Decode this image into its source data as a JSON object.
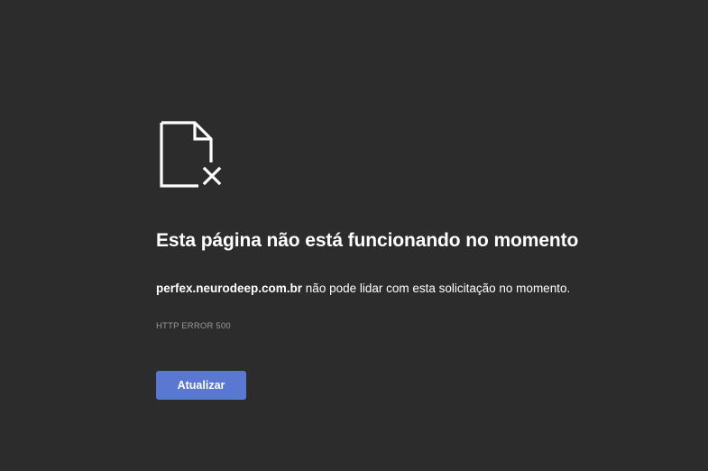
{
  "error_page": {
    "icon": "broken-document-icon",
    "title": "Esta página não está funcionando no momento",
    "host": "perfex.neurodeep.com.br",
    "message_suffix": " não pode lidar com esta solicitação no momento.",
    "error_code": "HTTP ERROR 500",
    "reload_label": "Atualizar"
  },
  "colors": {
    "background": "#2c2c2d",
    "text": "#ffffff",
    "muted_text": "#9a9a9a",
    "button": "#5a77d1"
  }
}
